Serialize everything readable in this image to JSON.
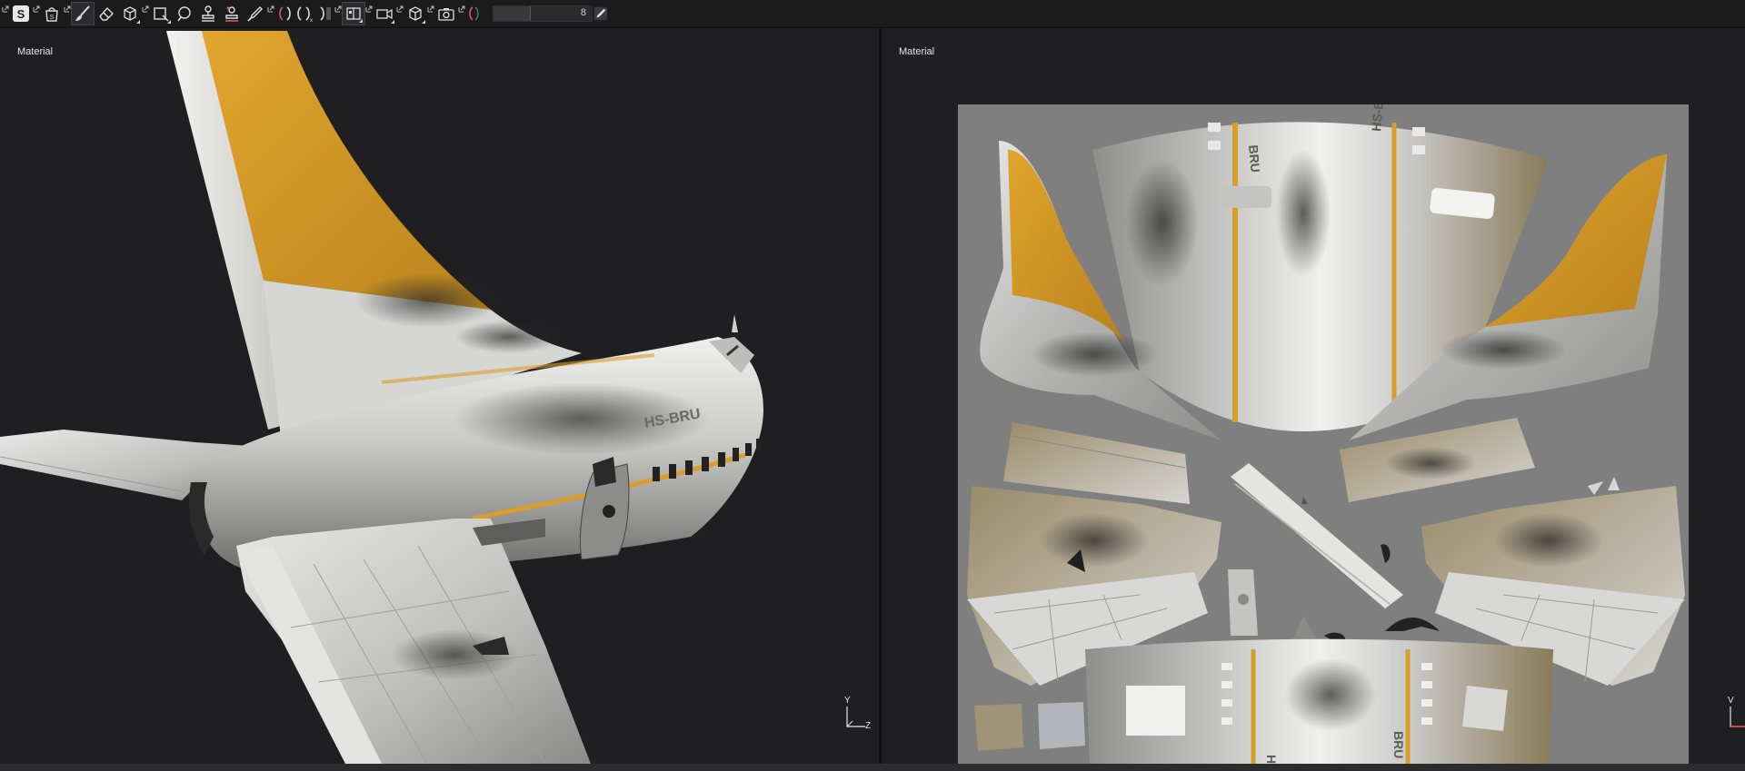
{
  "toolbar": {
    "tools": [
      {
        "name": "substance-logo-icon"
      },
      {
        "name": "shelf-bag-icon"
      },
      {
        "name": "paint-brush-icon"
      },
      {
        "name": "eraser-icon"
      },
      {
        "name": "projection-icon"
      },
      {
        "name": "polygon-fill-icon"
      },
      {
        "name": "smudge-icon"
      },
      {
        "name": "clone-stamp-icon"
      },
      {
        "name": "material-picker-icon"
      },
      {
        "name": "color-picker-icon"
      },
      {
        "name": "symmetry-icon"
      },
      {
        "name": "symmetry-x-icon"
      },
      {
        "name": "symmetry-mirror-icon"
      },
      {
        "name": "layout-viewports-icon"
      },
      {
        "name": "camera-video-icon"
      },
      {
        "name": "cube-view-icon"
      },
      {
        "name": "screenshot-camera-icon"
      },
      {
        "name": "brush-pressure-icon"
      },
      {
        "name": "pen-icon"
      }
    ],
    "brush_size_value": "8"
  },
  "viewports": {
    "left": {
      "label": "Material",
      "axis_y": "Y",
      "axis_z": "Z"
    },
    "right": {
      "label": "Material",
      "axis_y": "V"
    }
  },
  "colors": {
    "tail_yellow": "#d99d2b",
    "fuselage_white": "#d8d8d6",
    "uv_background": "#7f7f7f",
    "viewport_bg": "#1f1f22"
  },
  "model": {
    "registration_left": "HS-BRU",
    "registration_uv_top_left": "BRU",
    "registration_uv_top_right": "HS-B",
    "registration_uv_bottom_left": "HS",
    "registration_uv_bottom_right": "BRU"
  }
}
